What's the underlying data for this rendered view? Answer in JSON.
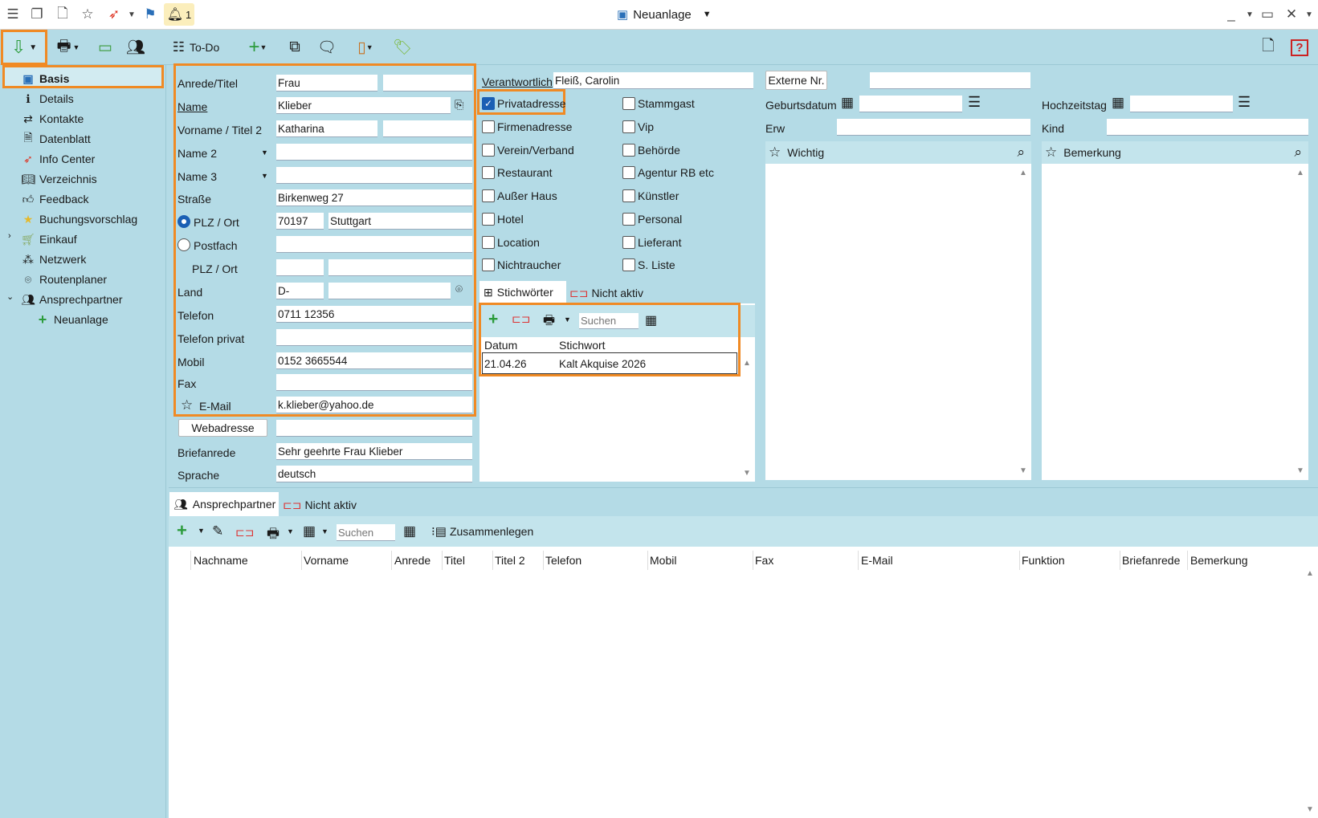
{
  "window": {
    "title": "Neuanlage",
    "notif_count": "1"
  },
  "toolbar": {
    "todo_label": "To-Do"
  },
  "sidebar": {
    "items": [
      {
        "label": "Basis",
        "icon": "person-card-icon"
      },
      {
        "label": "Details",
        "icon": "info-icon"
      },
      {
        "label": "Kontakte",
        "icon": "arrows-icon"
      },
      {
        "label": "Datenblatt",
        "icon": "document-icon"
      },
      {
        "label": "Info Center",
        "icon": "compass-icon"
      },
      {
        "label": "Verzeichnis",
        "icon": "book-icon"
      },
      {
        "label": "Feedback",
        "icon": "thumbs-up-icon"
      },
      {
        "label": "Buchungsvorschlag",
        "icon": "star-icon"
      },
      {
        "label": "Einkauf",
        "icon": "cart-icon"
      },
      {
        "label": "Netzwerk",
        "icon": "network-icon"
      },
      {
        "label": "Routenplaner",
        "icon": "location-pin-icon"
      },
      {
        "label": "Ansprechpartner",
        "icon": "people-icon"
      },
      {
        "label": "Neuanlage",
        "icon": "plus-icon"
      }
    ]
  },
  "form": {
    "anrede_label": "Anrede/Titel",
    "anrede": "Frau",
    "titel": "",
    "name_label": "Name",
    "name": "Klieber",
    "vorname_label": "Vorname / Titel 2",
    "vorname": "Katharina",
    "titel2": "",
    "name2_label": "Name 2",
    "name2": "",
    "name3_label": "Name 3",
    "name3": "",
    "strasse_label": "Straße",
    "strasse": "Birkenweg 27",
    "plzort_label": "PLZ / Ort",
    "plz": "70197",
    "ort": "Stuttgart",
    "postfach_label": "Postfach",
    "postfach": "",
    "plzort2_label": "PLZ / Ort",
    "plz2": "",
    "ort2": "",
    "land_label": "Land",
    "land": "D-",
    "land2": "",
    "telefon_label": "Telefon",
    "telefon": "0711 12356",
    "telefon_privat_label": "Telefon privat",
    "telefon_privat": "",
    "mobil_label": "Mobil",
    "mobil": "0152 3665544",
    "fax_label": "Fax",
    "fax": "",
    "email_label": "E-Mail",
    "email": "k.klieber@yahoo.de",
    "webadresse_label": "Webadresse",
    "webadresse": "",
    "briefanrede_label": "Briefanrede",
    "briefanrede": "Sehr geehrte Frau Klieber",
    "sprache_label": "Sprache",
    "sprache": "deutsch"
  },
  "middle": {
    "verantwortlich_label": "Verantwortlich",
    "verantwortlich": "Fleiß, Carolin",
    "checkboxes_left": [
      {
        "label": "Privatadresse",
        "checked": true
      },
      {
        "label": "Firmenadresse",
        "checked": false
      },
      {
        "label": "Verein/Verband",
        "checked": false
      },
      {
        "label": "Restaurant",
        "checked": false
      },
      {
        "label": "Außer Haus",
        "checked": false
      },
      {
        "label": "Hotel",
        "checked": false
      },
      {
        "label": "Location",
        "checked": false
      },
      {
        "label": "Nichtraucher",
        "checked": false
      }
    ],
    "checkboxes_right": [
      {
        "label": "Stammgast",
        "checked": false
      },
      {
        "label": "Vip",
        "checked": false
      },
      {
        "label": "Behörde",
        "checked": false
      },
      {
        "label": "Agentur RB etc",
        "checked": false
      },
      {
        "label": "Künstler",
        "checked": false
      },
      {
        "label": "Personal",
        "checked": false
      },
      {
        "label": "Lieferant",
        "checked": false
      },
      {
        "label": "S. Liste",
        "checked": false
      }
    ],
    "tabs": [
      "Stichwörter",
      "Nicht aktiv"
    ],
    "search_placeholder": "Suchen",
    "columns": [
      "Datum",
      "Stichwort"
    ],
    "rows": [
      {
        "datum": "21.04.26",
        "stichwort": "Kalt Akquise 2026"
      }
    ]
  },
  "right": {
    "externe_label": "Externe Nr.",
    "externe": "",
    "geburtsdatum_label": "Geburtsdatum",
    "geburtsdatum": "",
    "hochzeitstag_label": "Hochzeitstag",
    "hochzeitstag": "",
    "erw_label": "Erw",
    "erw": "",
    "kind_label": "Kind",
    "kind": "",
    "wichtig_label": "Wichtig",
    "bemerkung_label": "Bemerkung"
  },
  "bottom": {
    "tabs": [
      "Ansprechpartner",
      "Nicht aktiv"
    ],
    "search_placeholder": "Suchen",
    "zusammenlegen_label": "Zusammenlegen",
    "columns": [
      "Nachname",
      "Vorname",
      "Anrede",
      "Titel",
      "Titel 2",
      "Telefon",
      "Mobil",
      "Fax",
      "E-Mail",
      "Funktion",
      "Briefanrede",
      "Bemerkung"
    ]
  },
  "colors": {
    "accent": "#f08a24",
    "background": "#b4dbe6",
    "checkbox": "#1a5fb4"
  }
}
